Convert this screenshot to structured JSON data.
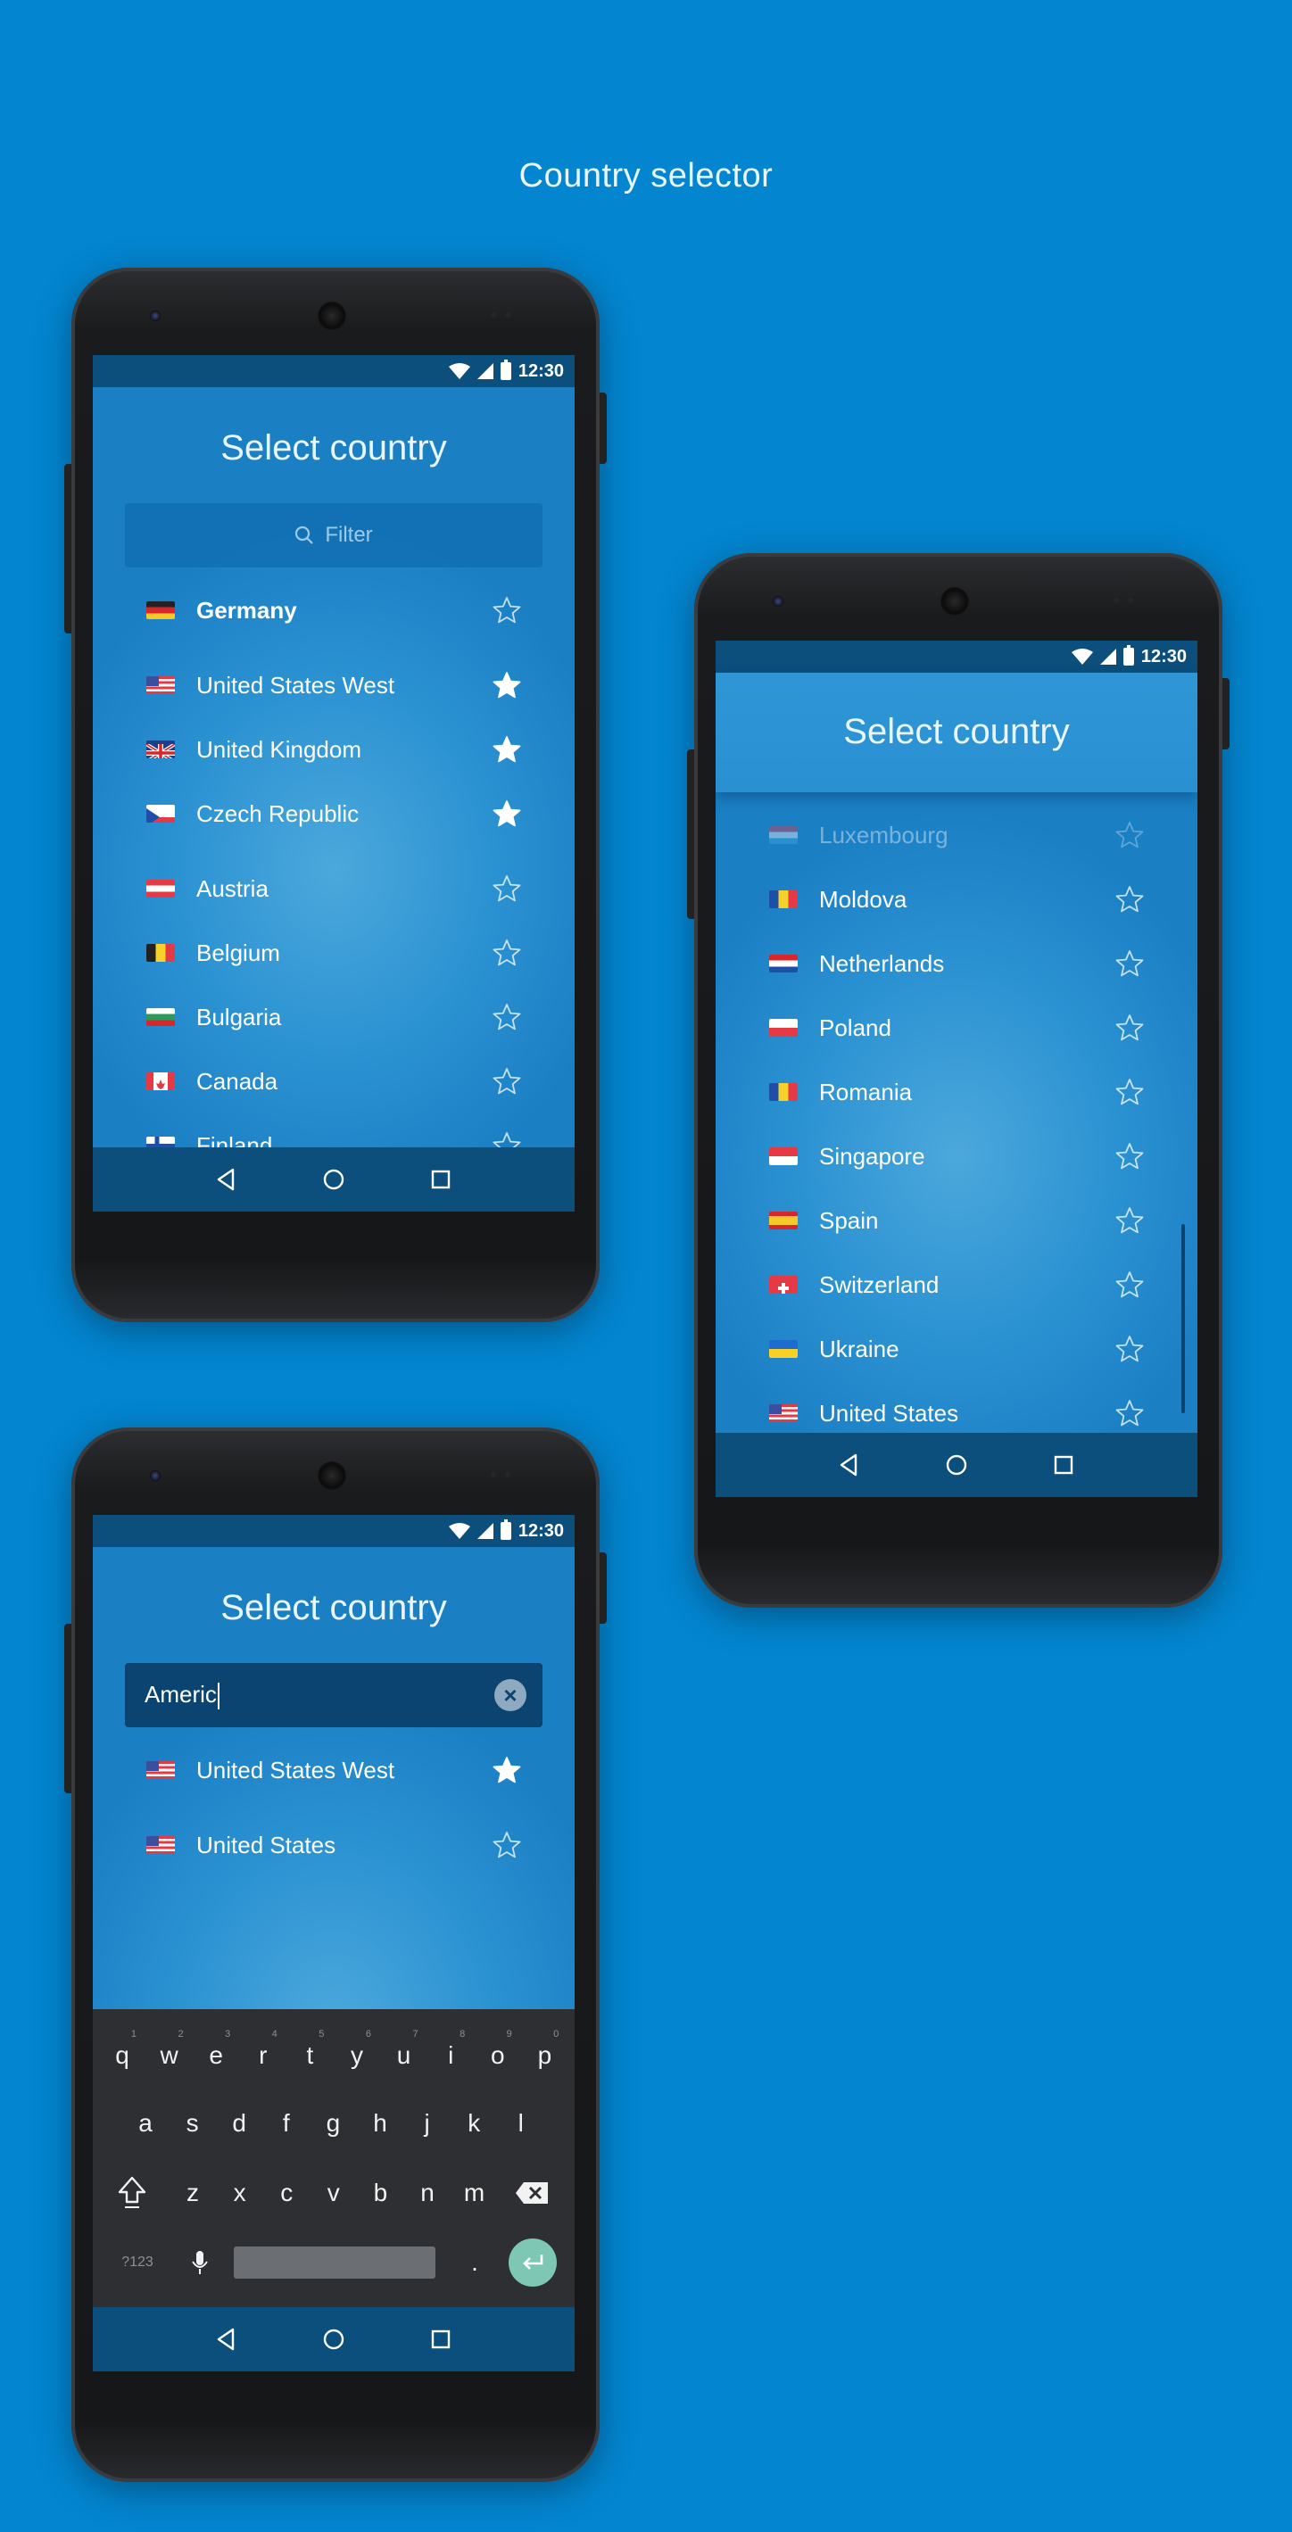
{
  "page": {
    "title": "Country selector"
  },
  "colors": {
    "background": "#0385d0",
    "bar": "#0c4f7c",
    "star": "#ffffff",
    "enter": "#7dc7b4"
  },
  "status": {
    "time": "12:30"
  },
  "screen1": {
    "title": "Select country",
    "filter_placeholder": "Filter",
    "items": [
      {
        "name": "Germany",
        "flag": "de",
        "starred": false,
        "bold": true
      },
      {
        "name": "United States West",
        "flag": "us",
        "starred": true
      },
      {
        "name": "United Kingdom",
        "flag": "gb",
        "starred": true
      },
      {
        "name": "Czech Republic",
        "flag": "cz",
        "starred": true
      },
      {
        "name": "Austria",
        "flag": "at",
        "starred": false
      },
      {
        "name": "Belgium",
        "flag": "be",
        "starred": false
      },
      {
        "name": "Bulgaria",
        "flag": "bg",
        "starred": false
      },
      {
        "name": "Canada",
        "flag": "ca",
        "starred": false
      },
      {
        "name": "Finland",
        "flag": "fi",
        "starred": false
      }
    ]
  },
  "screen2": {
    "title": "Select country",
    "items": [
      {
        "name": "Luxembourg",
        "flag": "lu",
        "starred": false
      },
      {
        "name": "Moldova",
        "flag": "md",
        "starred": false
      },
      {
        "name": "Netherlands",
        "flag": "nl",
        "starred": false
      },
      {
        "name": "Poland",
        "flag": "pl",
        "starred": false
      },
      {
        "name": "Romania",
        "flag": "ro",
        "starred": false
      },
      {
        "name": "Singapore",
        "flag": "sg",
        "starred": false
      },
      {
        "name": "Spain",
        "flag": "es",
        "starred": false
      },
      {
        "name": "Switzerland",
        "flag": "ch",
        "starred": false
      },
      {
        "name": "Ukraine",
        "flag": "ua",
        "starred": false
      },
      {
        "name": "United States",
        "flag": "us",
        "starred": false
      }
    ]
  },
  "screen3": {
    "title": "Select country",
    "search_value": "Americ",
    "items": [
      {
        "name": "United States West",
        "flag": "us",
        "starred": true
      },
      {
        "name": "United States",
        "flag": "us",
        "starred": false
      }
    ],
    "keyboard": {
      "row1": [
        "q",
        "w",
        "e",
        "r",
        "t",
        "y",
        "u",
        "i",
        "o",
        "p"
      ],
      "row1_hints": [
        "1",
        "2",
        "3",
        "4",
        "5",
        "6",
        "7",
        "8",
        "9",
        "0"
      ],
      "row2": [
        "a",
        "s",
        "d",
        "f",
        "g",
        "h",
        "j",
        "k",
        "l"
      ],
      "row3": [
        "z",
        "x",
        "c",
        "v",
        "b",
        "n",
        "m"
      ],
      "symbols_key": "?123",
      "period_key": "."
    }
  }
}
